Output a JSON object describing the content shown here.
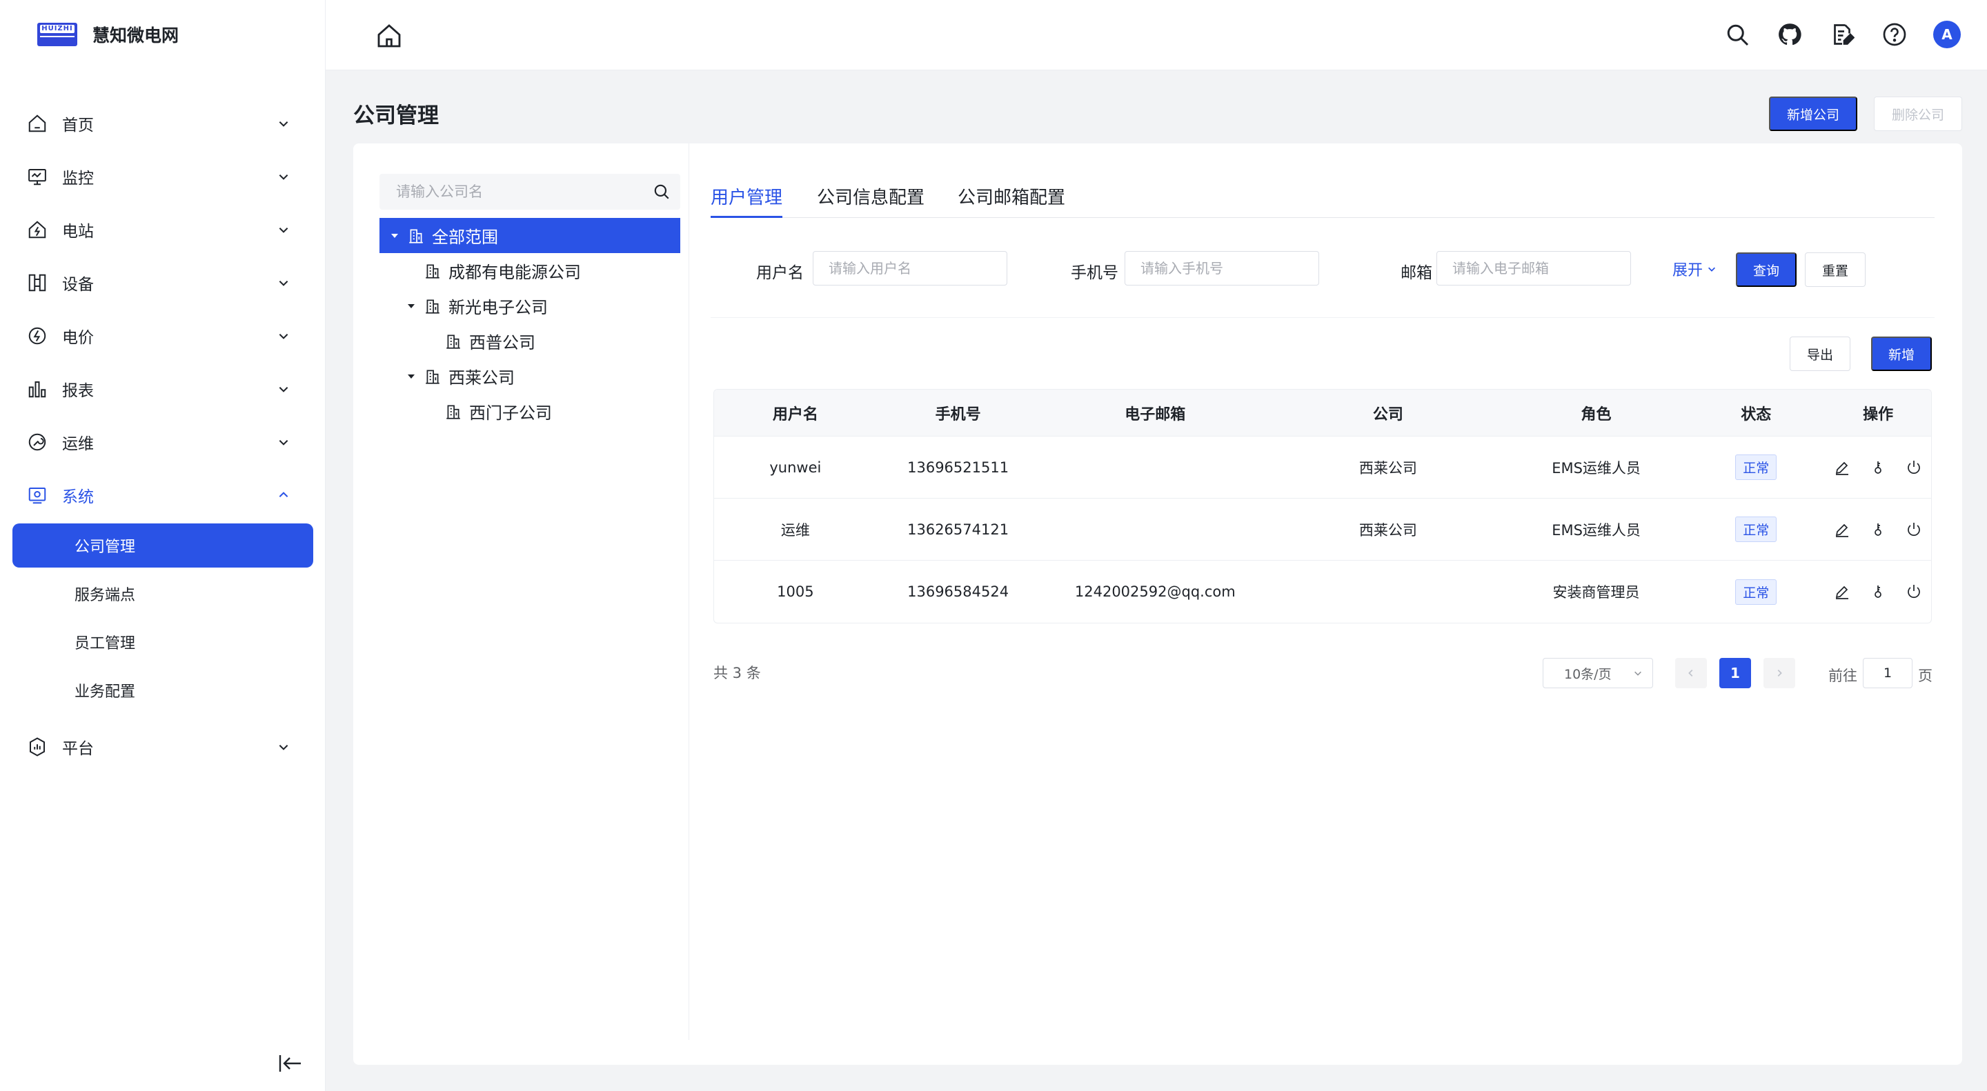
{
  "app": {
    "logo_mark": "HUIZHI",
    "logo_text": "慧知微电网"
  },
  "sidebar": {
    "items": [
      {
        "label": "首页",
        "icon": "home-icon"
      },
      {
        "label": "监控",
        "icon": "monitor-icon"
      },
      {
        "label": "电站",
        "icon": "station-icon"
      },
      {
        "label": "设备",
        "icon": "device-icon"
      },
      {
        "label": "电价",
        "icon": "price-icon"
      },
      {
        "label": "报表",
        "icon": "report-icon"
      },
      {
        "label": "运维",
        "icon": "maintenance-icon"
      },
      {
        "label": "系统",
        "icon": "system-icon"
      }
    ],
    "sub_items": [
      "公司管理",
      "服务端点",
      "员工管理",
      "业务配置"
    ],
    "last_item": {
      "label": "平台",
      "icon": "platform-icon"
    }
  },
  "topbar": {
    "avatar_initial": "A"
  },
  "page": {
    "title": "公司管理",
    "add_company": "新增公司",
    "delete_company": "删除公司"
  },
  "tree": {
    "search_placeholder": "请输入公司名",
    "nodes": [
      "全部范围",
      "成都有电能源公司",
      "新光电子公司",
      "西普公司",
      "西莱公司",
      "西门子公司"
    ]
  },
  "tabs": [
    "用户管理",
    "公司信息配置",
    "公司邮箱配置"
  ],
  "filters": {
    "username_label": "用户名",
    "username_placeholder": "请输入用户名",
    "phone_label": "手机号",
    "phone_placeholder": "请输入手机号",
    "email_label": "邮箱",
    "email_placeholder": "请输入电子邮箱",
    "expand": "展开",
    "query": "查询",
    "reset": "重置"
  },
  "actions": {
    "export": "导出",
    "add": "新增"
  },
  "table": {
    "headers": [
      "用户名",
      "手机号",
      "电子邮箱",
      "公司",
      "角色",
      "状态",
      "操作"
    ],
    "rows": [
      {
        "username": "yunwei",
        "phone": "13696521511",
        "email": "",
        "company": "西莱公司",
        "role": "EMS运维人员",
        "status": "正常"
      },
      {
        "username": "运维",
        "phone": "13626574121",
        "email": "",
        "company": "西莱公司",
        "role": "EMS运维人员",
        "status": "正常"
      },
      {
        "username": "1005",
        "phone": "13696584524",
        "email": "1242002592@qq.com",
        "company": "",
        "role": "安装商管理员",
        "status": "正常"
      }
    ]
  },
  "pagination": {
    "total": "共 3 条",
    "page_size": "10条/页",
    "current_page": "1",
    "goto_label": "前往",
    "goto_value": "1",
    "goto_suffix": "页"
  }
}
